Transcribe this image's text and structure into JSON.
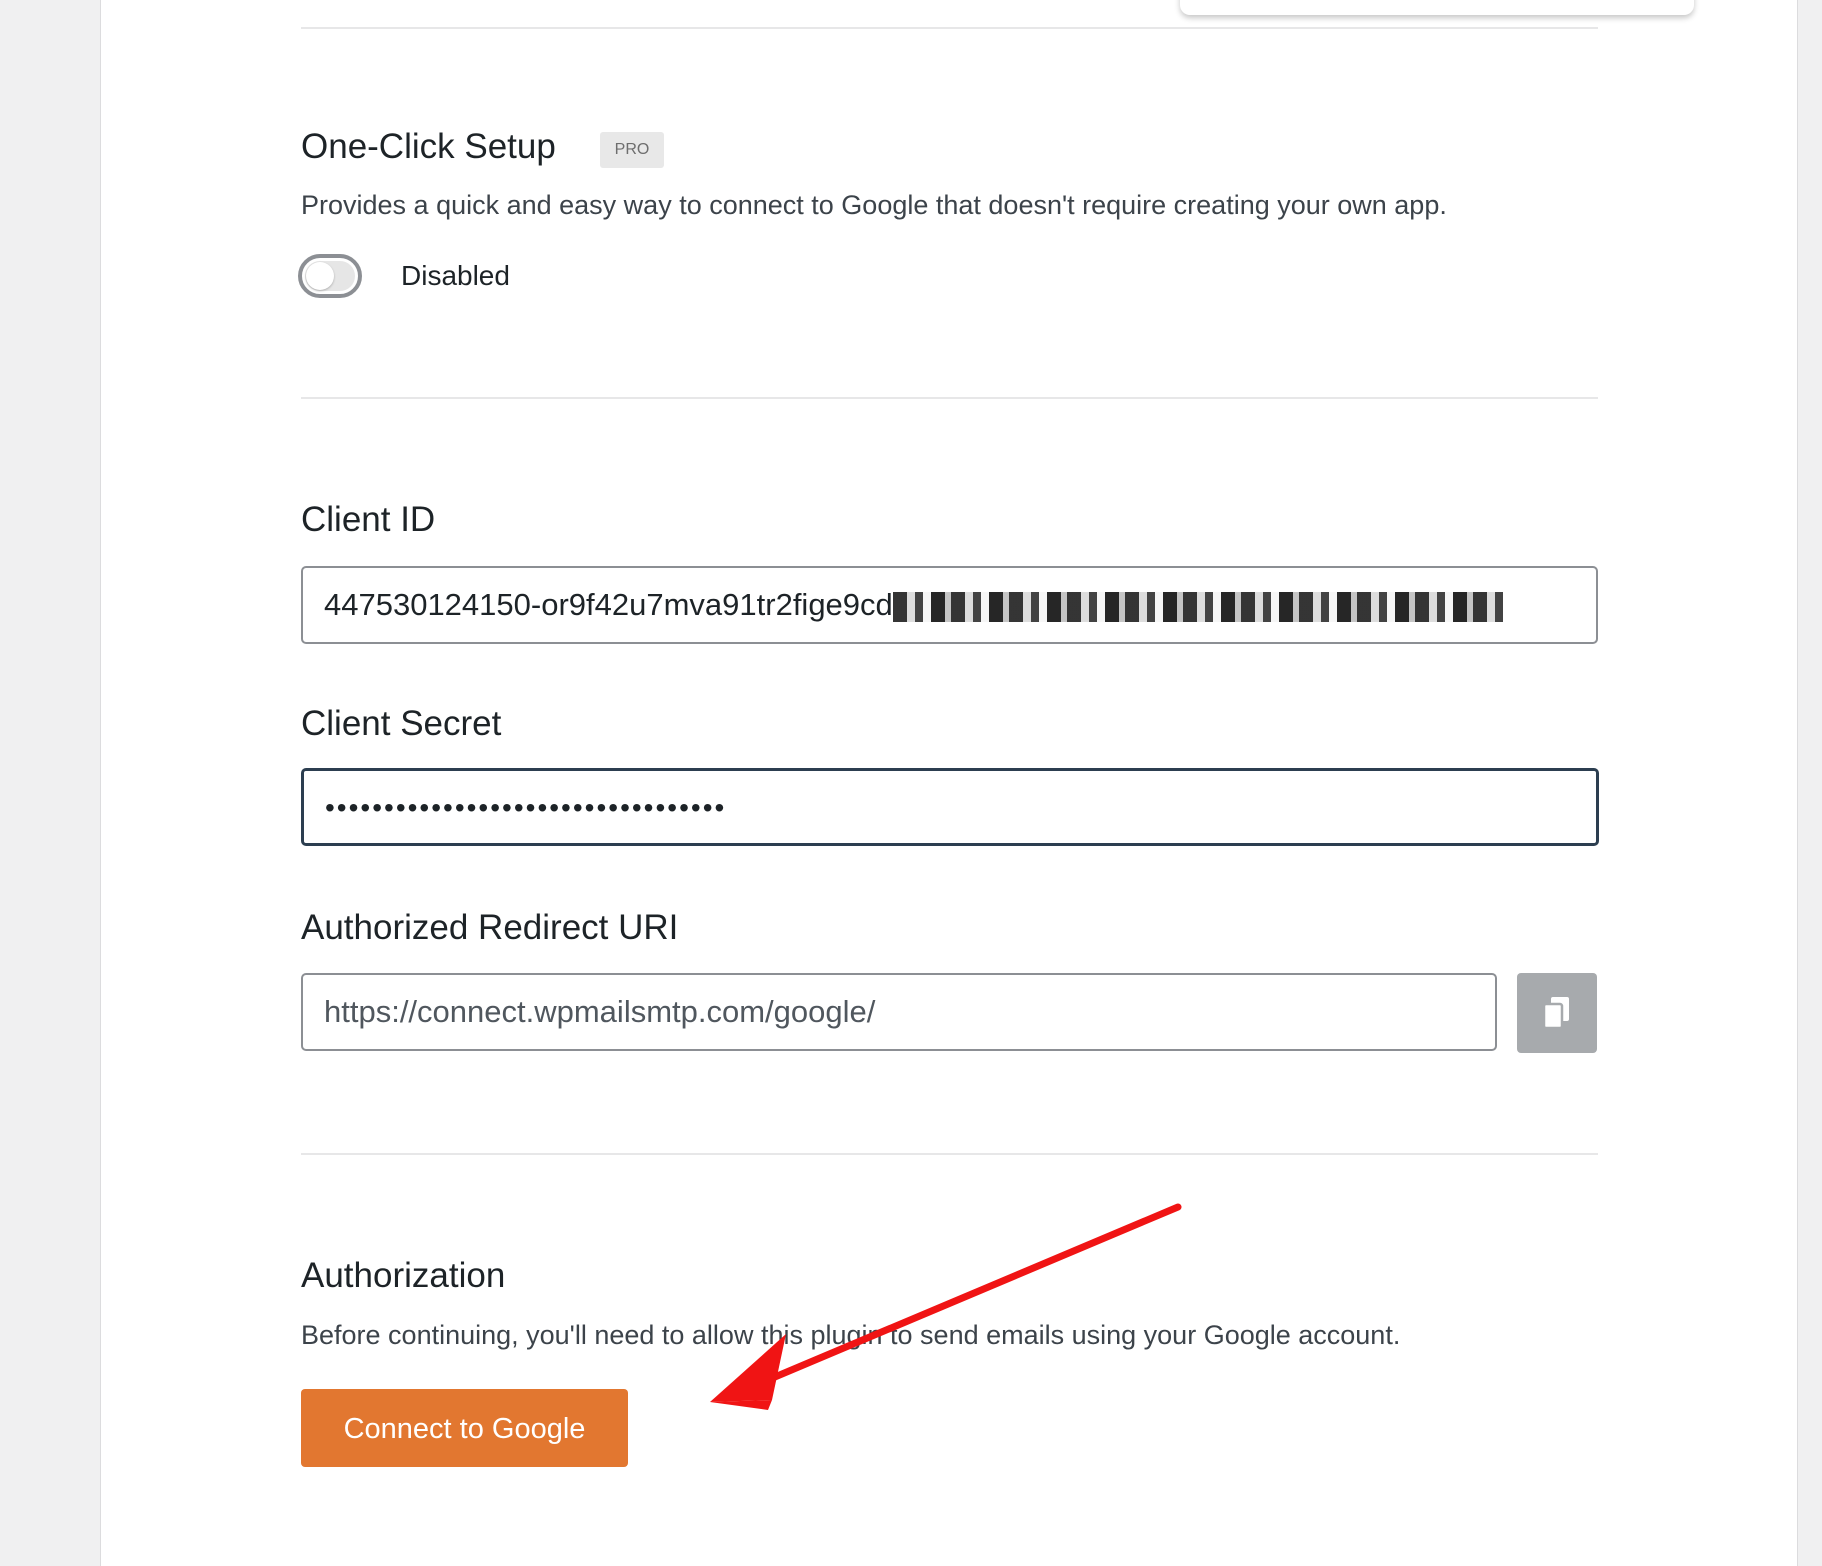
{
  "one_click": {
    "title": "One-Click Setup",
    "badge": "PRO",
    "description": "Provides a quick and easy way to connect to Google that doesn't require creating your own app.",
    "toggle_state": "Disabled",
    "toggle_on": false
  },
  "client_id": {
    "label": "Client ID",
    "value_visible": "447530124150-or9f42u7mva91tr2fige9cd"
  },
  "client_secret": {
    "label": "Client Secret",
    "masked_value": "••••••••••••••••••••••••••••••••••"
  },
  "redirect_uri": {
    "label": "Authorized Redirect URI",
    "value": "https://connect.wpmailsmtp.com/google/",
    "copy_icon": "copy-icon"
  },
  "authorization": {
    "title": "Authorization",
    "description": "Before continuing, you'll need to allow this plugin to send emails using your Google account.",
    "button_label": "Connect to Google"
  },
  "colors": {
    "accent_button": "#e27730",
    "annotation_arrow": "#f01414",
    "focus_border": "#2c3e50"
  }
}
